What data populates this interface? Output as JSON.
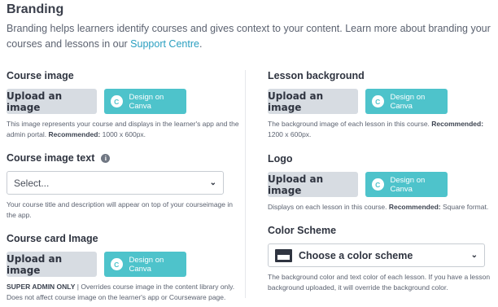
{
  "page": {
    "title": "Branding",
    "intro": "Branding helps learners identify courses and gives context to your content. Learn more about branding your courses and lessons in our ",
    "intro_link": "Support Centre",
    "intro_end": "."
  },
  "common": {
    "upload_label": "Upload an image",
    "canva_label": "Design on Canva",
    "canva_glyph": "C"
  },
  "course_image": {
    "title": "Course image",
    "help": "This image represents your course and displays in the learner's app and the admin portal. ",
    "recommended_label": "Recommended:",
    "recommended_value": " 1000 x 600px."
  },
  "course_image_text": {
    "title": "Course image text",
    "info_glyph": "i",
    "select_value": "Select...",
    "help": "Your course title and description will appear on top of your courseimage in the app."
  },
  "course_card_image": {
    "title": "Course card Image",
    "badge": "SUPER ADMIN ONLY",
    "help": " | Overrides course image in the content library only. Does not affect course image on the learner's app or Courseware page."
  },
  "lesson_background": {
    "title": "Lesson background",
    "help": "The background image of each lesson in this course. ",
    "recommended_label": "Recommended:",
    "recommended_value": " 1200 x 600px."
  },
  "logo": {
    "title": "Logo",
    "help": "Displays on each lesson in this course. ",
    "recommended_label": "Recommended:",
    "recommended_value": " Square format."
  },
  "color_scheme": {
    "title": "Color Scheme",
    "select_value": "Choose a color scheme",
    "help": "The background color and text color of each lesson. If you have a lesson background uploaded, it will override the background color."
  },
  "icons": {
    "chevron": "chevron-down-icon",
    "info": "info-icon",
    "canva": "canva-icon",
    "swatch": "color-swatch-icon"
  },
  "colors": {
    "accent": "#4ec3cb",
    "link": "#2a9fc0",
    "upload_bg": "#d7dce2"
  }
}
